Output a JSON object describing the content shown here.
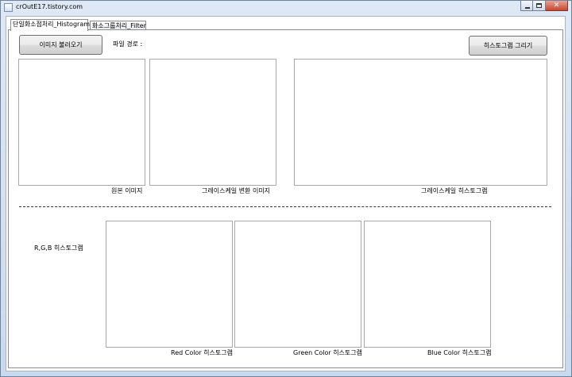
{
  "window": {
    "title": "crOutE17.tistory.com"
  },
  "tabs": [
    {
      "label": "단일화소점처리_Histogram"
    },
    {
      "label": "화소그룹처리_Filter"
    }
  ],
  "histogram_tab": {
    "load_button": "이미지 불러오기",
    "file_path_label": "파일 경로 :",
    "draw_button": "히스토그램 그리기",
    "original_label": "원본 이미지",
    "grayscale_label": "그레이스케일 변환 이미지",
    "grayscale_hist_label": "그레이스케일 히스토그램",
    "rgb_label": "R,G,B 히스토그램",
    "red_label": "Red Color 히스토그램",
    "green_label": "Green Color 히스토그램",
    "blue_label": "Blue Color 히스토그램"
  }
}
